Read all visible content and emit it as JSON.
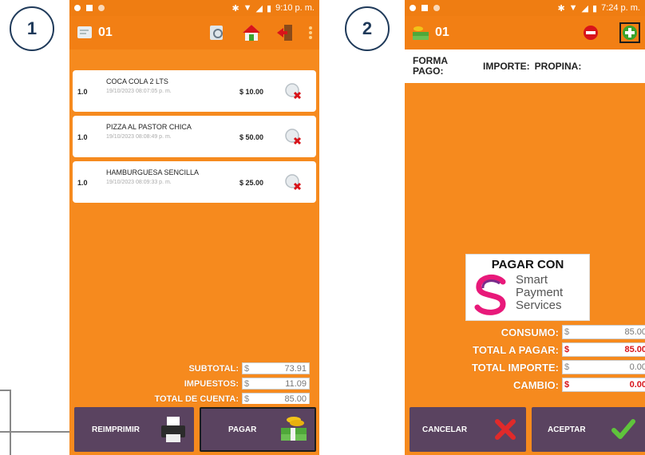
{
  "steps": {
    "one": "1",
    "two": "2"
  },
  "phone1": {
    "status": {
      "time": "9:10 p. m."
    },
    "account": "01",
    "items": [
      {
        "qty": "1.0",
        "name": "COCA COLA 2 LTS",
        "time": "19/10/2023 08:07:05 p. m.",
        "price": "$ 10.00"
      },
      {
        "qty": "1.0",
        "name": "PIZZA AL PASTOR CHICA",
        "time": "19/10/2023 08:08:49 p. m.",
        "price": "$ 50.00"
      },
      {
        "qty": "1.0",
        "name": "HAMBURGUESA SENCILLA",
        "time": "19/10/2023 08:09:33 p. m.",
        "price": "$ 25.00"
      }
    ],
    "totals": {
      "subtotal_label": "SUBTOTAL:",
      "subtotal": "73.91",
      "impuestos_label": "IMPUESTOS:",
      "impuestos": "11.09",
      "total_label": "TOTAL DE CUENTA:",
      "total": "85.00",
      "currency": "$"
    },
    "buttons": {
      "reimprimir": "REIMPRIMIR",
      "pagar": "PAGAR"
    }
  },
  "phone2": {
    "status": {
      "time": "7:24 p. m."
    },
    "account": "01",
    "header": {
      "forma_pago": "FORMA PAGO:",
      "importe": "IMPORTE:",
      "propina": "PROPINA:"
    },
    "sps": {
      "title": "PAGAR CON",
      "line1": "Smart",
      "line2": "Payment",
      "line3": "Services"
    },
    "totals": {
      "consumo_label": "CONSUMO:",
      "consumo": "85.00",
      "total_pagar_label": "TOTAL A PAGAR:",
      "total_pagar": "85.00",
      "total_importe_label": "TOTAL IMPORTE:",
      "total_importe": "0.00",
      "cambio_label": "CAMBIO:",
      "cambio": "0.00",
      "currency": "$"
    },
    "buttons": {
      "cancelar": "CANCELAR",
      "aceptar": "ACEPTAR"
    }
  },
  "colors": {
    "orange": "#f68a1e",
    "appbar": "#f27f14",
    "button": "#5a4360",
    "accent_red": "#d8141a",
    "accent_green": "#3aa32c",
    "badge": "#1f3a5a"
  }
}
